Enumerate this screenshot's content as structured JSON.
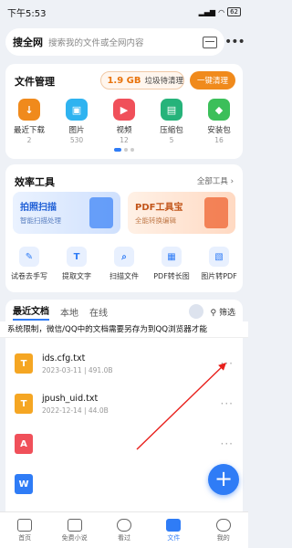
{
  "status": {
    "time": "下午5:53",
    "battery": "62"
  },
  "search": {
    "brand": "搜全网",
    "placeholder": "搜索我的文件或全网内容"
  },
  "file_mgmt": {
    "title": "文件管理",
    "storage_amount": "1.9 GB",
    "storage_label": "垃圾待清理",
    "clean_button": "一键清理",
    "categories": [
      {
        "name": "最近下载",
        "count": "2",
        "icon": "download-icon",
        "color": "#f08a1c"
      },
      {
        "name": "图片",
        "count": "530",
        "icon": "image-icon",
        "color": "#2fb3f0"
      },
      {
        "name": "视频",
        "count": "12",
        "icon": "video-icon",
        "color": "#f0505a"
      },
      {
        "name": "压缩包",
        "count": "5",
        "icon": "zip-icon",
        "color": "#26b37a"
      },
      {
        "name": "安装包",
        "count": "16",
        "icon": "apk-icon",
        "color": "#3cbf5a"
      }
    ]
  },
  "tools": {
    "title": "效率工具",
    "all_link": "全部工具 ›",
    "promo1": {
      "title": "拍照扫描",
      "subtitle": "智能扫描处理"
    },
    "promo2": {
      "title": "PDF工具宝",
      "subtitle": "全能转换编辑"
    },
    "items": [
      {
        "name": "试卷去手写",
        "icon": "eraser-icon"
      },
      {
        "name": "提取文字",
        "icon": "text-extract-icon"
      },
      {
        "name": "扫描文件",
        "icon": "scan-file-icon"
      },
      {
        "name": "PDF转长图",
        "icon": "pdf-long-image-icon"
      },
      {
        "name": "图片转PDF",
        "icon": "image-to-pdf-icon"
      }
    ]
  },
  "docs": {
    "tabs": [
      "最近文档",
      "本地",
      "在线"
    ],
    "filter": "筛选",
    "notice": "系统限制，微信/QQ中的文档需要另存为到QQ浏览器才能",
    "files": [
      {
        "name": "ids.cfg.txt",
        "date": "2023-03-11",
        "size": "491.0B",
        "icon": "txt-icon",
        "color": "#f5a623"
      },
      {
        "name": "jpush_uid.txt",
        "date": "2022-12-14",
        "size": "44.0B",
        "icon": "txt-icon",
        "color": "#f5a623"
      },
      {
        "name": "",
        "date": "",
        "size": "",
        "icon": "pdf-icon",
        "color": "#f0505a"
      },
      {
        "name": "",
        "date": "",
        "size": "",
        "icon": "word-icon",
        "color": "#2f7cf6"
      }
    ]
  },
  "nav": [
    {
      "label": "首页",
      "icon": "home-icon"
    },
    {
      "label": "免费小说",
      "icon": "book-icon"
    },
    {
      "label": "看过",
      "icon": "history-icon"
    },
    {
      "label": "文件",
      "icon": "folder-icon"
    },
    {
      "label": "我的",
      "icon": "user-icon"
    }
  ]
}
